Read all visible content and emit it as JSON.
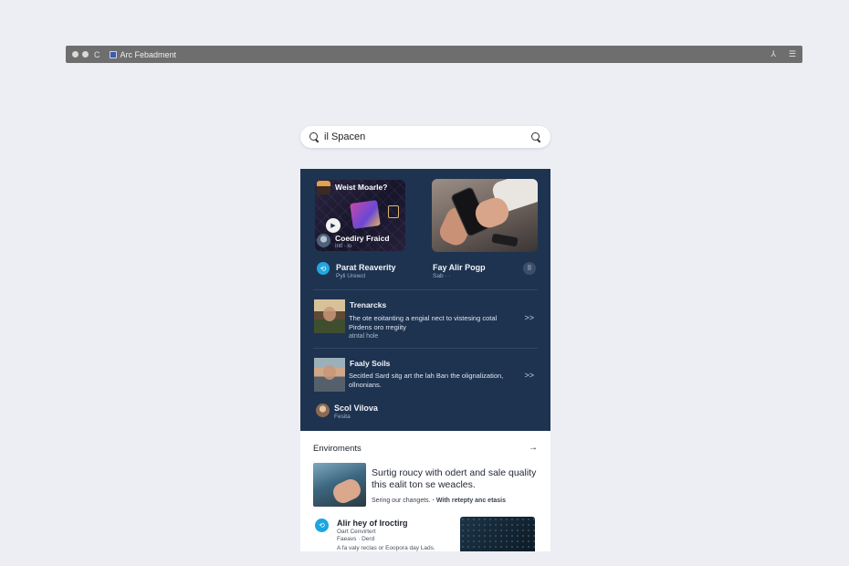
{
  "browser": {
    "tab_title": "Arc Febadment",
    "reload_icon": "C",
    "right_icons": [
      "share-icon",
      "menu-icon"
    ]
  },
  "search": {
    "value": "il Spacen"
  },
  "panel": {
    "card_left": {
      "title": "Weist Moarle?",
      "subtitle": "Coediry Fraicd",
      "meta": "Intl  ·  lo"
    },
    "row_left": {
      "title": "Parat Reaverity",
      "sub": "Pyli Urewcl"
    },
    "row_right": {
      "title": "Fay Alir Pogp",
      "sub": "Sab  ·  ·"
    },
    "list": [
      {
        "title": "Trenarcks",
        "desc": "The ote eoitanting a engial nect to vistesing cotal",
        "desc2": "Pirdens oro rregiity",
        "desc3": "atntal hole"
      },
      {
        "title": "Faaly Soils",
        "desc": "Secitled Sard sitg art the lah Ban the olignalization,",
        "desc2": "ollnonians."
      }
    ],
    "footer": {
      "name": "Scol Vilova",
      "sub": "Fesita"
    }
  },
  "section": {
    "title": "Enviroments",
    "feature": {
      "text": "Surtig roucy with odert and sale quality this ealit ton se weacles.",
      "sub_plain": "Sering our changets.",
      "sub_bold": "· With retepty anc etasis"
    },
    "article": {
      "title": "Alir hey of Iroctirg",
      "sub1": "Oart Cenvirtert",
      "sub2": "Faeavs  ·  Derd",
      "caption": "A fa valy reclas or Eoopora day Lads."
    }
  },
  "colors": {
    "panel_bg": "#1e3350",
    "accent_teal": "#22a7e0",
    "page_bg": "#eceef4"
  }
}
